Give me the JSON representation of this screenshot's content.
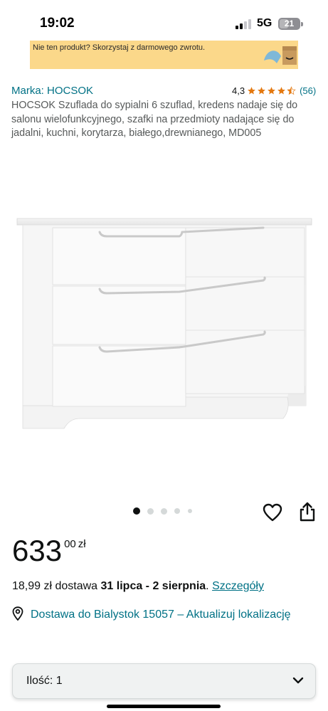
{
  "status_bar": {
    "time": "19:02",
    "network": "5G",
    "battery": "21",
    "signal_bars": 2
  },
  "banner": {
    "text": "Nie ten produkt? Skorzystaj z darmowego zwrotu."
  },
  "product": {
    "brand": "Marka: HOCSOK",
    "rating_value": "4,3",
    "rating_stars": 4.3,
    "rating_count": "(56)",
    "title": "HOCSOK Szuflada do sypialni 6 szuflad, kredens nadaje się do salonu wielofunkcyjnego, szafki na przedmioty nadające się do jadalni, kuchni, korytarza, białego,drewnianego, MD005"
  },
  "carousel": {
    "active_index": 0,
    "count": 5
  },
  "price": {
    "whole": "633",
    "fraction": "00",
    "currency": "zł"
  },
  "delivery": {
    "cost": "18,99 zł dostawa",
    "dates": "31 lipca - 2 sierpnia",
    "suffix": ".",
    "details_link": "Szczegóły"
  },
  "location": {
    "text": "Dostawa do Bialystok 15057 – Aktualizuj lokalizację"
  },
  "quantity": {
    "label": "Ilość:",
    "value": "1"
  },
  "colors": {
    "link": "#007185",
    "star": "#e47911",
    "banner": "#fbd88a"
  },
  "icons": {
    "heart": "heart-icon",
    "share": "share-icon",
    "pin": "location-pin-icon",
    "chevron": "chevron-down-icon"
  }
}
